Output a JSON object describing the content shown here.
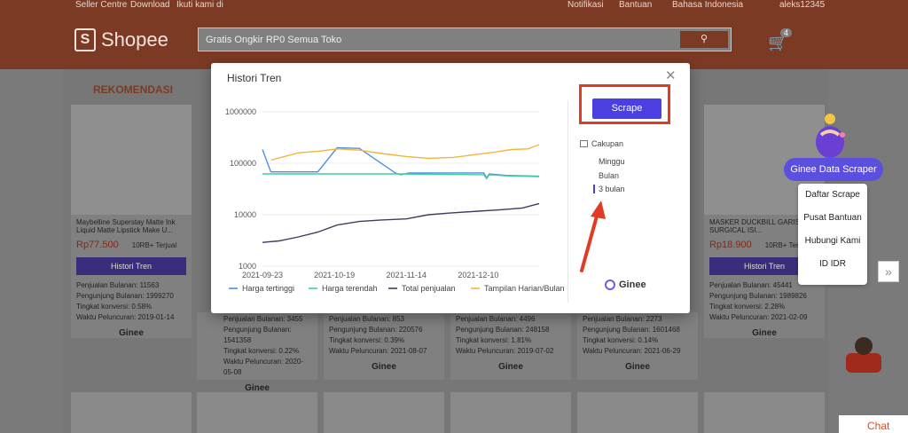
{
  "topbar": {
    "seller_centre": "Seller Centre",
    "download": "Download",
    "follow": "Ikuti kami di",
    "notifications": "Notifikasi",
    "help": "Bantuan",
    "language": "Bahasa Indonesia",
    "username": "aleks12345"
  },
  "header": {
    "brand": "Shopee",
    "search_value": "Gratis Ongkir RP0 Semua Toko",
    "cart_count": "4"
  },
  "section_title": "REKOMENDASI",
  "cards": [
    {
      "title": "Maybelline Superstay Matte Ink Liquid Matte Lipstick Make U...",
      "price": "Rp77.500",
      "sold": "10RB+ Terjual",
      "history_btn": "Histori Tren",
      "stats": [
        "Penjualan Bulanan: 11563",
        "Pengunjung Bulanan: 1999270",
        "Tingkat konversi: 0.58%",
        "Waktu Peluncuran: 2019-01-14"
      ],
      "ginee": "Ginee"
    },
    {
      "title": "MASKER DUCKBILL GARIS 3PLY SURGICAL ISI...",
      "price": "Rp18.900",
      "sold": "10RB+ Terjual",
      "history_btn": "Histori Tren",
      "stats": [
        "Penjualan Bulanan: 45441",
        "Pengunjung Bulanan: 1989826",
        "Tingkat konversi: 2.28%",
        "Waktu Peluncuran: 2021-02-09"
      ],
      "ginee": "Ginee"
    }
  ],
  "partial_stats": [
    {
      "a": "Pengunjung Bulanan: 1541358",
      "b": "Tingkat konversi: 0.22%",
      "c": "Waktu Peluncuran: 2020-05-08",
      "s": "Penjualan Bulanan: 3455"
    },
    {
      "a": "Pengunjung Bulanan: 220576",
      "b": "Tingkat konversi: 0.39%",
      "c": "Waktu Peluncuran: 2021-08-07",
      "s": "Penjualan Bulanan: 853"
    },
    {
      "a": "Pengunjung Bulanan: 248158",
      "b": "Tingkat konversi: 1.81%",
      "c": "Waktu Peluncuran: 2019-07-02",
      "s": "Penjualan Bulanan: 4496"
    },
    {
      "a": "Pengunjung Bulanan: 1601468",
      "b": "Tingkat konversi: 0.14%",
      "c": "Waktu Peluncuran: 2021-06-29",
      "s": "Penjualan Bulanan: 2273"
    }
  ],
  "widget": {
    "button": "Ginee Data Scraper",
    "menu": [
      "Daftar Scrape",
      "Pusat Bantuan",
      "Hubungi Kami",
      "ID  IDR"
    ],
    "chat": "Chat"
  },
  "modal": {
    "title": "Histori Tren",
    "scrape_btn": "Scrape",
    "coverage_label": "Cakupan",
    "ranges": [
      "Minggu",
      "Bulan",
      "3 bulan"
    ],
    "active_range": "3 bulan",
    "brand": "Ginee"
  },
  "chart_data": {
    "type": "line",
    "yscale": "log",
    "ylim": [
      1000,
      1000000
    ],
    "yticks": [
      "1000000",
      "100000",
      "10000",
      "1000"
    ],
    "xticks": [
      "2021-09-23",
      "2021-10-19",
      "2021-11-14",
      "2021-12-10"
    ],
    "x_start": "2021-09-23",
    "x_end": "2022-01-01",
    "series": [
      {
        "name": "Harga tertinggi",
        "color": "#4e8fdf",
        "x": [
          "2021-09-23",
          "2021-09-26",
          "2021-10-13",
          "2021-10-20",
          "2021-10-28",
          "2021-11-10",
          "2021-11-12",
          "2021-11-15",
          "2021-12-12",
          "2021-12-13",
          "2021-12-14",
          "2021-12-20",
          "2022-01-01"
        ],
        "values": [
          185000,
          68000,
          68000,
          200000,
          195000,
          65000,
          60000,
          65000,
          65000,
          52000,
          62000,
          58000,
          56000
        ]
      },
      {
        "name": "Harga terendah",
        "color": "#3fcf9f",
        "x": [
          "2021-09-23",
          "2021-10-13",
          "2021-11-10",
          "2021-12-12",
          "2021-12-13",
          "2021-12-14",
          "2021-12-20",
          "2022-01-01"
        ],
        "values": [
          62000,
          62000,
          62000,
          60000,
          50000,
          60000,
          57000,
          55000
        ]
      },
      {
        "name": "Total penjualan",
        "color": "#3b3f5c",
        "x": [
          "2021-09-23",
          "2021-09-29",
          "2021-10-06",
          "2021-10-13",
          "2021-10-20",
          "2021-10-28",
          "2021-11-05",
          "2021-11-14",
          "2021-11-22",
          "2021-12-01",
          "2021-12-10",
          "2021-12-18",
          "2021-12-26",
          "2022-01-01"
        ],
        "values": [
          2900,
          3100,
          3700,
          4600,
          6300,
          7400,
          7900,
          8300,
          10000,
          10900,
          11700,
          12500,
          13500,
          16500
        ]
      },
      {
        "name": "Tampilan Harian/Bulan",
        "color": "#f3b43c",
        "x": [
          "2021-09-26",
          "2021-10-06",
          "2021-10-13",
          "2021-10-20",
          "2021-10-28",
          "2021-11-05",
          "2021-11-14",
          "2021-11-22",
          "2021-12-01",
          "2021-12-10",
          "2021-12-16",
          "2021-12-22",
          "2021-12-28",
          "2022-01-01"
        ],
        "values": [
          115000,
          160000,
          170000,
          190000,
          180000,
          155000,
          135000,
          125000,
          130000,
          150000,
          165000,
          185000,
          190000,
          230000
        ]
      }
    ]
  }
}
